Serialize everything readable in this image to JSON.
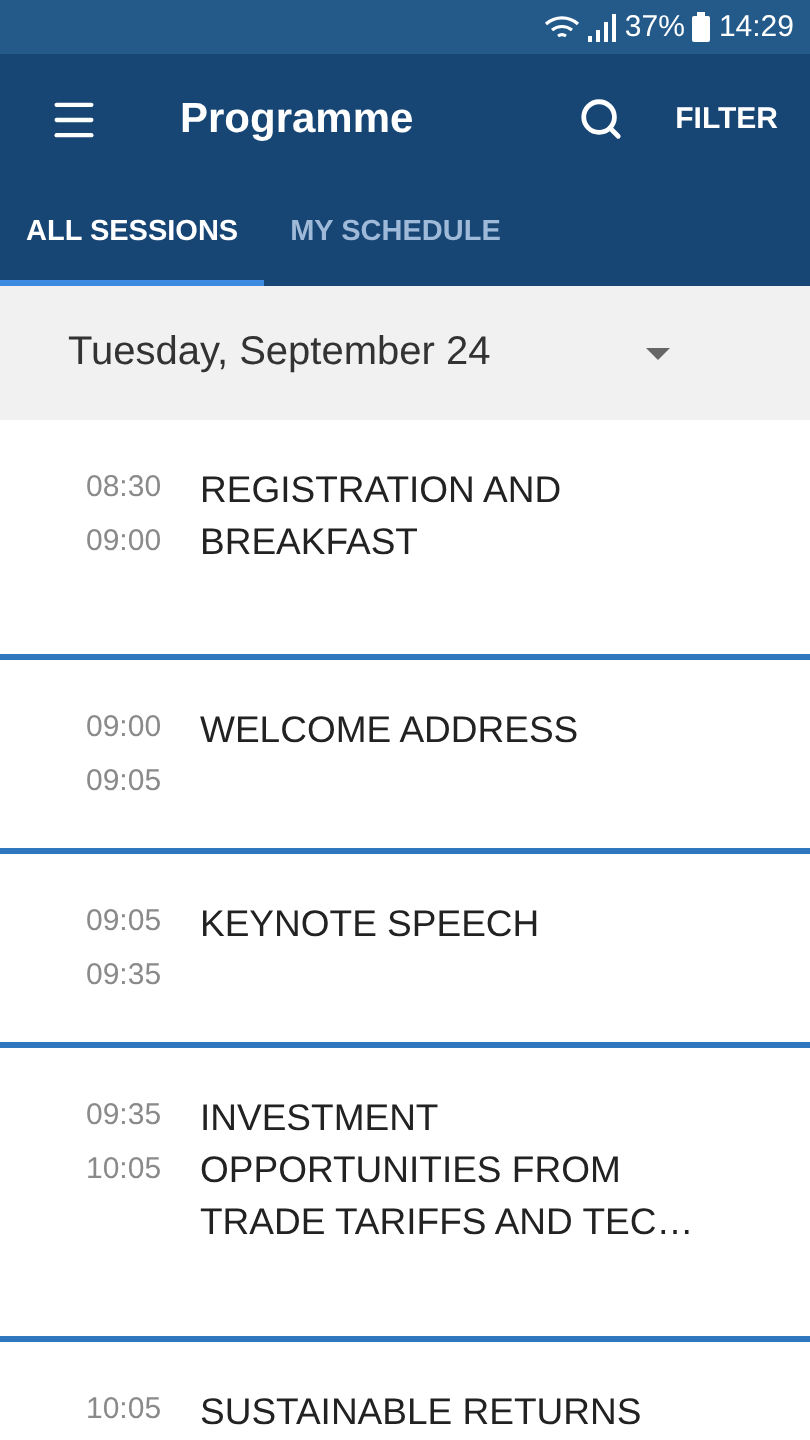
{
  "status_bar": {
    "battery": "37%",
    "time": "14:29"
  },
  "app_bar": {
    "title": "Programme",
    "action": "FILTER"
  },
  "tabs": [
    {
      "label": "ALL SESSIONS",
      "selected": true
    },
    {
      "label": "MY SCHEDULE",
      "selected": false
    }
  ],
  "date_picker": {
    "value": "Tuesday, September 24"
  },
  "sessions": [
    {
      "start": "08:30",
      "end": "09:00",
      "title": "REGISTRATION AND BREAKFAST"
    },
    {
      "start": "09:00",
      "end": "09:05",
      "title": "WELCOME ADDRESS"
    },
    {
      "start": "09:05",
      "end": "09:35",
      "title": "KEYNOTE SPEECH"
    },
    {
      "start": "09:35",
      "end": "10:05",
      "title": "INVESTMENT OPPORTUNITIES FROM TRADE TARIFFS AND TEC…"
    },
    {
      "start": "10:05",
      "title": "SUSTAINABLE RETURNS"
    }
  ]
}
